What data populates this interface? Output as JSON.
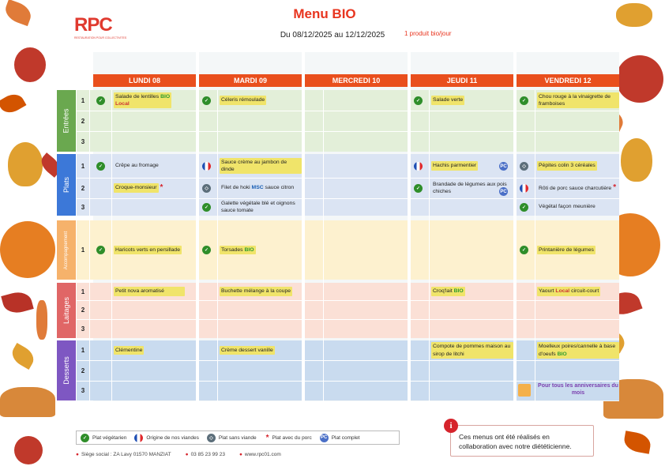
{
  "header": {
    "logo": "RPC",
    "logo_sub": "RESTAURATION POUR COLLECTIVITES",
    "title": "Menu BIO",
    "dates": "Du 08/12/2025 au 12/12/2025",
    "bio_per_day": "1 produit bio/jour"
  },
  "days": [
    "LUNDI 08",
    "MARDI 09",
    "MERCREDI 10",
    "JEUDI 11",
    "VENDREDI 12"
  ],
  "categories": [
    {
      "label": "Entrées",
      "color": "#6aa84f"
    },
    {
      "label": "Plats",
      "color": "#3c78d8"
    },
    {
      "label": "Accompagnement",
      "color": "#f6b26b"
    },
    {
      "label": "Laitages",
      "color": "#e06666"
    },
    {
      "label": "Desserts",
      "color": "#7e57c2"
    }
  ],
  "rownums": [
    "1",
    "2",
    "3"
  ],
  "menu": {
    "entrees": {
      "l1": "Salade de lentilles",
      "l1_bio": "BIO",
      "l1_local": "Local",
      "m1": "Céleris rémoulade",
      "j1": "Salade verte",
      "v1": "Chou rouge à la vinaigrette de framboises"
    },
    "plats": {
      "l1": "Crêpe au fromage",
      "l2": "Croque-monsieur",
      "m1": "Sauce crème au jambon de dinde",
      "m2a": "Filet de hoki",
      "m2_msc": "MSC",
      "m2b": "sauce citron",
      "m3": "Galette végétale blé et oignons sauce tomate",
      "j1": "Hachis parmentier",
      "j2": "Brandade de légumes aux pois chiches",
      "v1": "Pépites colin 3 céréales",
      "v2": "Rôti de porc sauce charcutière",
      "v3": "Végétal façon meunière"
    },
    "accompagnement": {
      "l1": "Haricots verts en persillade",
      "m1": "Torsades",
      "m1_bio": "BIO",
      "v1": "Printanière de légumes"
    },
    "laitages": {
      "l1": "Petit nova aromatisé",
      "m1": "Buchette mélange à la coupe",
      "j1": "Croq'lait",
      "j1_bio": "BIO",
      "v1a": "Yaourt",
      "v1_local": "Local",
      "v1b": "circuit-court"
    },
    "desserts": {
      "l1": "Clémentine",
      "m1": "Crème dessert vanille",
      "j1": "Compote de pommes maison au sirop de litchi",
      "v1": "Moelleux poires/cannelle à base d'oeufs",
      "v1_bio": "BIO",
      "v3": "Pour tous les anniversaires du mois"
    }
  },
  "legend": {
    "veg": "Plat végétarien",
    "fr": "Origine de nos viandes",
    "fish": "Plat sans viande",
    "pork": "Plat avec du porc",
    "pc": "Plat complet",
    "pc_icon": "PC",
    "veg_icon": "leaf-icon"
  },
  "footer": {
    "address": "Siège social : ZA Lavy 01570 MANZIAT",
    "phone": "03 85 23 99 23",
    "web": "www.rpc01.com"
  },
  "note": {
    "text": "Ces menus ont été réalisés en collaboration avec notre diététicienne.",
    "icon": "i"
  },
  "colors": {
    "accent": "#e94f1d",
    "title": "#e8351f",
    "bio": "#2e9b2f"
  }
}
